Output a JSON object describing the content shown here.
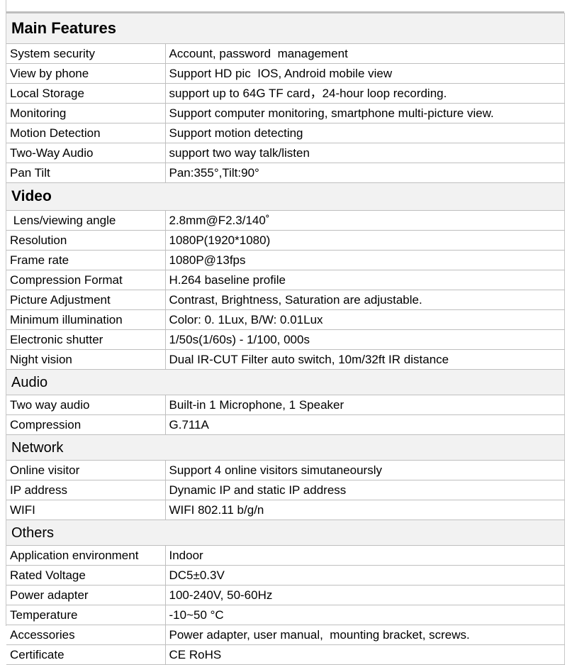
{
  "document": {
    "title": "Main Features",
    "colors": {
      "section_background": "#f2f2f2",
      "grid_line": "#bfbfbf",
      "text": "#000000",
      "page_background": "#ffffff"
    }
  },
  "sections": [
    {
      "heading": "Main Features",
      "emphasis": "bold",
      "rows": [
        {
          "label": "System security",
          "value": "Account, password  management"
        },
        {
          "label": "View by phone",
          "value": "Support HD pic  IOS, Android mobile view"
        },
        {
          "label": "Local Storage",
          "value": "support up to 64G TF card，24-hour loop recording."
        },
        {
          "label": "Monitoring",
          "value": "Support computer monitoring, smartphone multi-picture view."
        },
        {
          "label": "Motion Detection",
          "value": "Support motion detecting"
        },
        {
          "label": "Two-Way Audio",
          "value": "support two way talk/listen"
        },
        {
          "label": "Pan Tilt",
          "value": "Pan:355°,Tilt:90°"
        }
      ]
    },
    {
      "heading": "Video",
      "emphasis": "bold",
      "rows": [
        {
          "label": " Lens/viewing angle",
          "value": "2.8mm@F2.3/140˚"
        },
        {
          "label": "Resolution",
          "value": "1080P(1920*1080)"
        },
        {
          "label": "Frame rate",
          "value": "1080P@13fps"
        },
        {
          "label": "Compression Format",
          "value": "H.264 baseline profile"
        },
        {
          "label": "Picture Adjustment",
          "value": "Contrast, Brightness, Saturation are adjustable."
        },
        {
          "label": "Minimum illumination",
          "value": "Color: 0. 1Lux, B/W: 0.01Lux"
        },
        {
          "label": "Electronic shutter",
          "value": "1/50s(1/60s) - 1/100, 000s"
        },
        {
          "label": "Night vision",
          "value": "Dual IR-CUT Filter auto switch, 10m/32ft IR distance"
        }
      ]
    },
    {
      "heading": "Audio",
      "emphasis": "regular",
      "rows": [
        {
          "label": "Two way audio",
          "value": "Built-in 1 Microphone, 1 Speaker"
        },
        {
          "label": "Compression",
          "value": "G.711A"
        }
      ]
    },
    {
      "heading": "Network",
      "emphasis": "regular",
      "rows": [
        {
          "label": "Online visitor",
          "value": "Support 4 online visitors simutaneoursly"
        },
        {
          "label": "IP address",
          "value": "Dynamic IP and static IP address"
        },
        {
          "label": "WIFI",
          "value": "WIFI 802.11 b/g/n"
        }
      ]
    },
    {
      "heading": "Others",
      "emphasis": "regular",
      "rows": [
        {
          "label": "Application environment",
          "value": "Indoor"
        },
        {
          "label": "Rated Voltage",
          "value": "DC5±0.3V"
        },
        {
          "label": "Power adapter",
          "value": "100-240V, 50-60Hz"
        },
        {
          "label": "Temperature",
          "value": "-10~50 °C"
        },
        {
          "label": "Accessories",
          "value": "Power adapter, user manual,  mounting bracket, screws."
        },
        {
          "label": "Certificate",
          "value": "CE RoHS"
        }
      ]
    }
  ]
}
